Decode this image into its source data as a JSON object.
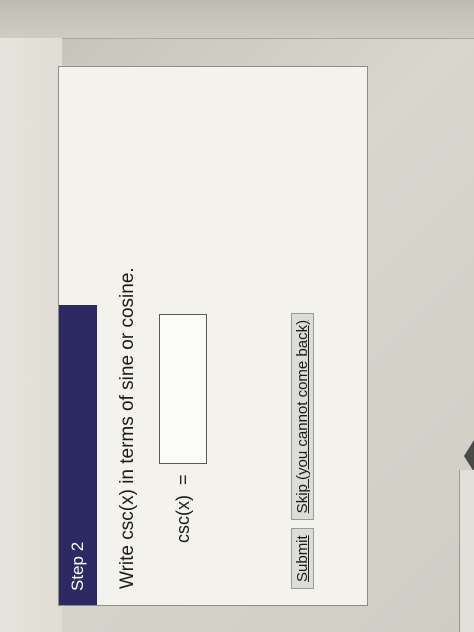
{
  "step": {
    "title": "Step 2"
  },
  "question": {
    "text": "Write csc(x) in terms of sine or cosine."
  },
  "equation": {
    "lhs": "csc(x)",
    "equals": "=",
    "answer_value": ""
  },
  "actions": {
    "submit_label": "Submit",
    "skip_label": "Skip (you cannot come back)"
  },
  "colors": {
    "step_bar": "#2d2a63",
    "panel_bg": "#f3f2ec",
    "button_bg": "#dcdcd8"
  }
}
